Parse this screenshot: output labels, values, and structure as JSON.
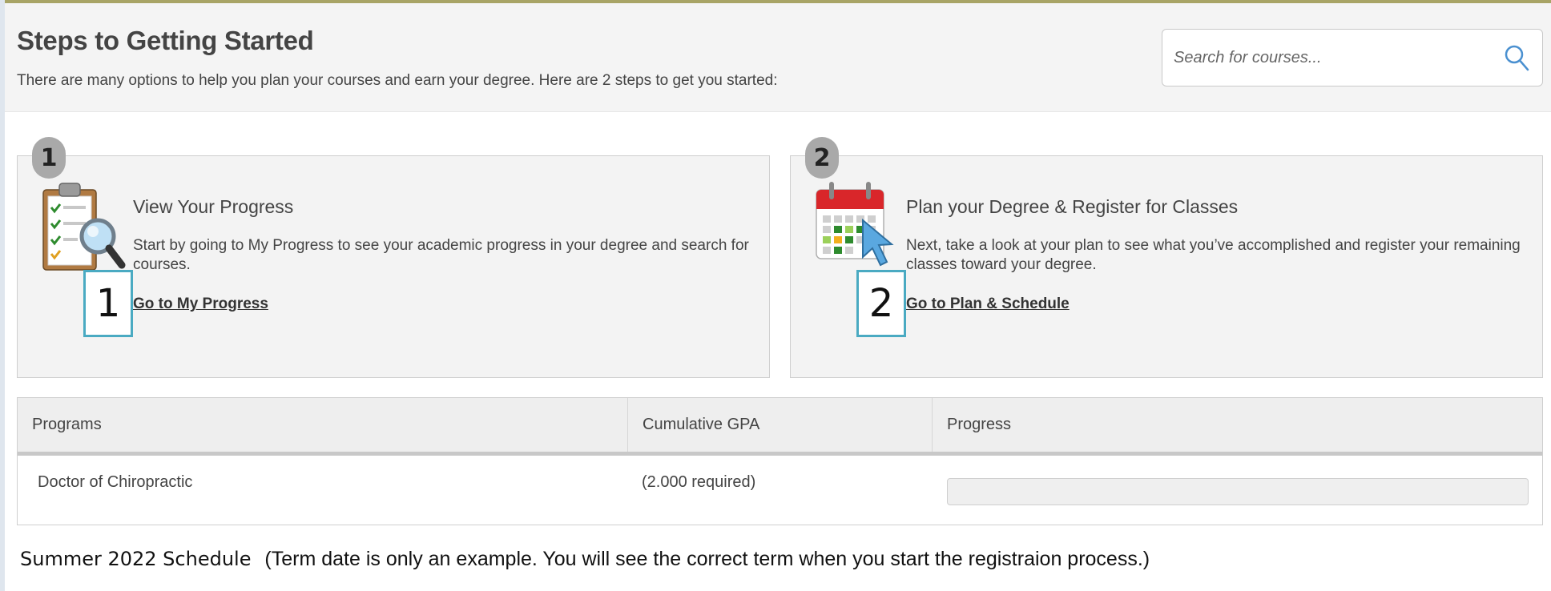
{
  "header": {
    "title": "Steps to Getting Started",
    "subtitle": "There are many options to help you plan your courses and earn your degree. Here are 2 steps to get you started:"
  },
  "search": {
    "placeholder": "Search for courses..."
  },
  "steps": [
    {
      "number": "1",
      "title": "View Your Progress",
      "description": "Start by going to My Progress to see your academic progress in your degree and search for courses.",
      "link_label": "Go to My Progress",
      "callout": "1",
      "icon": "clipboard-magnifier-icon"
    },
    {
      "number": "2",
      "title": "Plan your Degree & Register for Classes",
      "description": "Next, take a look at your plan to see what you’ve accomplished and register your remaining classes toward your degree.",
      "link_label": "Go to Plan & Schedule",
      "callout": "2",
      "icon": "calendar-cursor-icon"
    }
  ],
  "programs_table": {
    "headers": [
      "Programs",
      "Cumulative GPA",
      "Progress"
    ],
    "rows": [
      {
        "program": "Doctor of Chiropractic",
        "gpa": "(2.000 required)",
        "progress_fraction": 0
      }
    ]
  },
  "footer": {
    "term_label": "Summer 2022 Schedule",
    "term_note": "(Term date is only an example. You will see the correct term when you start the registraion process.)"
  },
  "colors": {
    "callout_border": "#4aaac2",
    "top_border": "#a8a466",
    "search_icon": "#4a90d0"
  }
}
